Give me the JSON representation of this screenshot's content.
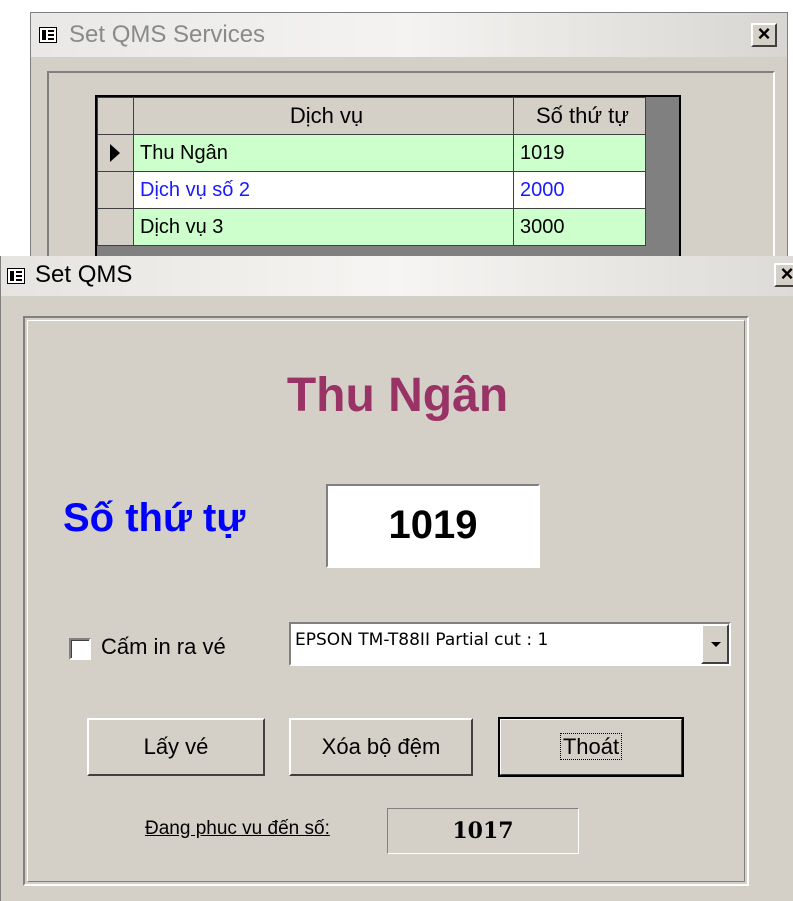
{
  "services_window": {
    "title": "Set QMS Services",
    "close": "×",
    "grid": {
      "headers": [
        "Dịch vụ",
        "Số thứ tự"
      ],
      "rows": [
        {
          "name": "Thu Ngân",
          "number": "1019",
          "selected": true
        },
        {
          "name": "Dịch vụ số 2",
          "number": "2000",
          "selected": false
        },
        {
          "name": "Dịch vụ 3",
          "number": "3000",
          "selected": false
        }
      ]
    }
  },
  "qms_window": {
    "title": "Set QMS",
    "close": "×",
    "service_name": "Thu Ngân",
    "sequence_label": "Số thứ tự",
    "sequence_value": "1019",
    "no_print_label": "Cấm in ra vé",
    "no_print_checked": false,
    "printer": "EPSON TM-T88II Partial cut : 1",
    "buttons": {
      "get_ticket": "Lấy vé",
      "clear_buffer": "Xóa bộ đệm",
      "exit": "Thoát"
    },
    "serving_label": "Đang phuc vu đến số:",
    "serving_value": "1017"
  },
  "colors": {
    "service_name": "#993366",
    "sequence_label": "#0000ff",
    "row_highlight": "#ccffcc",
    "row_alt_text": "#1a1aff"
  }
}
